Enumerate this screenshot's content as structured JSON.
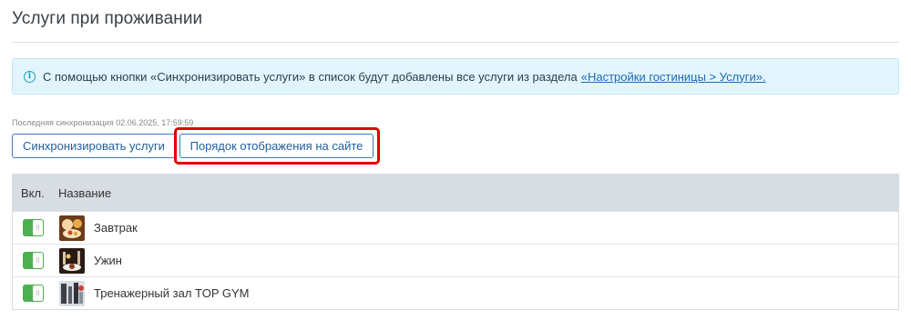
{
  "page": {
    "title": "Услуги при проживании"
  },
  "info": {
    "text": "С помощью кнопки «Синхронизировать услуги» в список будут добавлены все услуги из раздела",
    "link_text": "«Настройки гостиницы > Услуги».",
    "icon": "info-circle-icon",
    "accent_color": "#17a2b8"
  },
  "sync": {
    "status": "Последняя синхронизация 02.06.2025, 17:59:59"
  },
  "toolbar": {
    "sync_label": "Синхронизировать услуги",
    "order_label": "Порядок отображения на сайте",
    "highlight_color": "#e00000"
  },
  "table": {
    "columns": [
      "Вкл.",
      "Название"
    ],
    "rows": [
      {
        "enabled": true,
        "name": "Завтрак",
        "image": "breakfast-photo"
      },
      {
        "enabled": true,
        "name": "Ужин",
        "image": "dinner-photo"
      },
      {
        "enabled": true,
        "name": "Тренажерный зал TOP GYM",
        "image": "gym-photo"
      }
    ],
    "toggle_on_color": "#4caf50"
  }
}
